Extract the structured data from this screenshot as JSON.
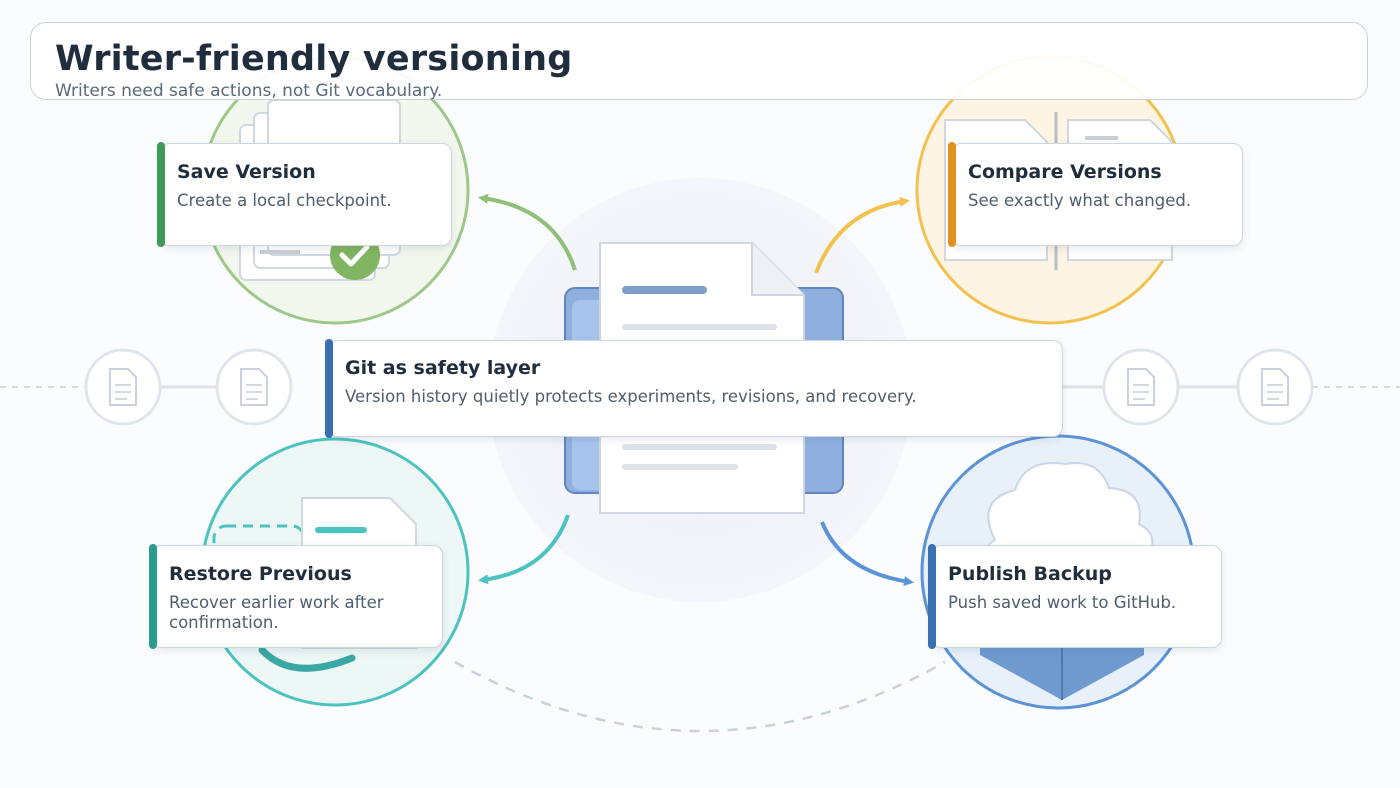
{
  "header": {
    "title": "Writer-friendly versioning",
    "subtitle": "Writers need safe actions, not Git vocabulary."
  },
  "center": {
    "title": "Git as safety layer",
    "desc": "Version history quietly protects experiments, revisions, and recovery.",
    "accent": "#3a6fb0"
  },
  "nodes": [
    {
      "title": "Save Version",
      "desc": "Create a local checkpoint.",
      "accent": "#3f9a5a",
      "icon": "stacked-documents-checkmark-icon"
    },
    {
      "title": "Compare Versions",
      "desc": "See exactly what changed.",
      "accent": "#e0921f",
      "icon": "side-by-side-documents-icon"
    },
    {
      "title": "Restore Previous",
      "desc": "Recover earlier work after confirmation.",
      "accent": "#2a9d8f",
      "icon": "document-restore-arrow-icon"
    },
    {
      "title": "Publish Backup",
      "desc": "Push saved work to GitHub.",
      "accent": "#3a6fb0",
      "icon": "cloud-box-icon"
    }
  ],
  "colors": {
    "save": "#8fc07a",
    "compare": "#f2c14e",
    "restore": "#4cc3c0",
    "publish": "#5b93d6",
    "track": "#d5dbe3"
  }
}
